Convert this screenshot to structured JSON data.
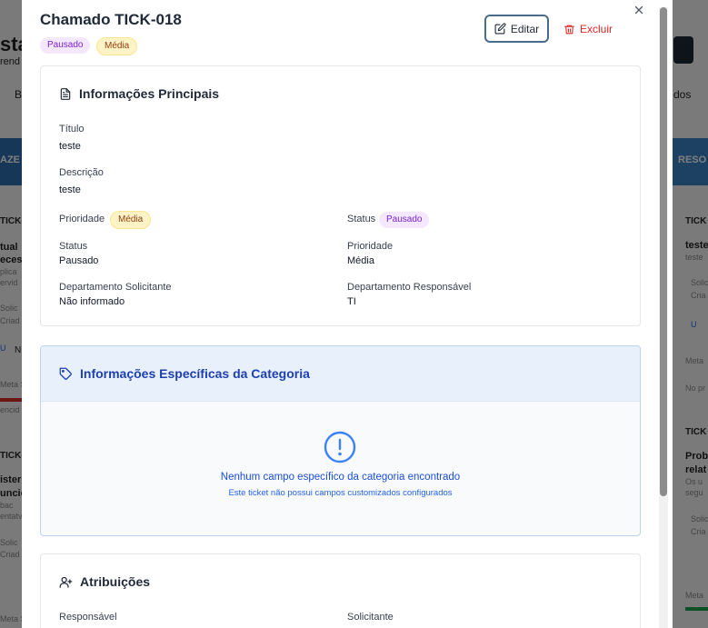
{
  "background": {
    "fragments": [
      "sta",
      "rend",
      "B",
      "dos",
      "n",
      "AZE",
      "RESO",
      "TICK-0",
      "tual",
      "eces",
      "plica",
      "ervid",
      "Solic",
      "Criad",
      "U",
      "N",
      "Meta S",
      "encid",
      "TICK-0",
      "ister",
      "uncic",
      "bac",
      "entatv",
      "Solic",
      "Criad",
      "Meta S",
      "TICK",
      "teste",
      "teste",
      "Solic",
      "Cria",
      "U",
      "Meta",
      "No pr",
      "TICK",
      "Prob",
      "relat",
      "Os u",
      "segu",
      "Solic",
      "Cria",
      "Meta"
    ]
  },
  "modal": {
    "title": "Chamado TICK-018",
    "badges": {
      "status": "Pausado",
      "priority": "Média"
    },
    "actions": {
      "edit": "Editar",
      "delete": "Excluir"
    },
    "main_info": {
      "heading": "Informações Principais",
      "titulo_label": "Título",
      "titulo_value": "teste",
      "descricao_label": "Descrição",
      "descricao_value": "teste",
      "prioridade_label": "Prioridade",
      "prioridade_badge": "Média",
      "status_label": "Status",
      "status_badge": "Pausado",
      "status_field_label": "Status",
      "status_field_value": "Pausado",
      "prioridade_field_label": "Prioridade",
      "prioridade_field_value": "Média",
      "dept_solicitante_label": "Departamento Solicitante",
      "dept_solicitante_value": "Não informado",
      "dept_responsavel_label": "Departamento Responsável",
      "dept_responsavel_value": "TI"
    },
    "category_info": {
      "heading": "Informações Específicas da Categoria",
      "empty_title": "Nenhum campo específico da categoria encontrado",
      "empty_subtitle": "Este ticket não possui campos customizados configurados"
    },
    "assignments": {
      "heading": "Atribuições",
      "responsavel_label": "Responsável",
      "solicitante_label": "Solicitante"
    }
  },
  "colors": {
    "accent": "#1d4ed8",
    "danger": "#dc2626",
    "paused_bg": "#f3e8ff",
    "media_bg": "#fef3c7"
  }
}
